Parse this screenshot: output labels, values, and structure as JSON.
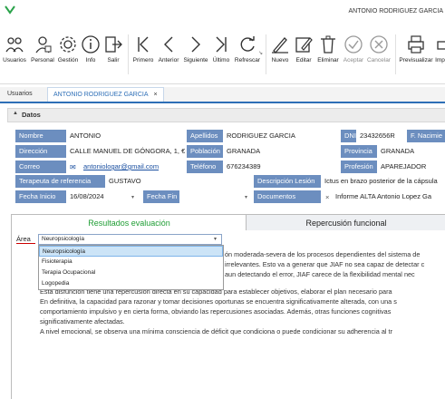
{
  "titlebar": {
    "user": "ANTONIO RODRIGUEZ GARCIA"
  },
  "ribbon": {
    "buttons": [
      {
        "label": "Usuarios",
        "icon": "users-icon"
      },
      {
        "label": "Personal",
        "icon": "staff-icon"
      },
      {
        "label": "Gestión",
        "icon": "gear-icon"
      },
      {
        "label": "Info",
        "icon": "info-icon"
      },
      {
        "label": "Salir",
        "icon": "exit-icon"
      },
      {
        "label": "Primero",
        "icon": "first-icon"
      },
      {
        "label": "Anterior",
        "icon": "previous-icon"
      },
      {
        "label": "Siguiente",
        "icon": "next-icon"
      },
      {
        "label": "Último",
        "icon": "last-icon"
      },
      {
        "label": "Refrescar",
        "icon": "refresh-icon"
      },
      {
        "label": "Nuevo",
        "icon": "new-icon"
      },
      {
        "label": "Editar",
        "icon": "edit-icon"
      },
      {
        "label": "Eliminar",
        "icon": "delete-icon"
      },
      {
        "label": "Aceptar",
        "icon": "accept-icon"
      },
      {
        "label": "Cancelar",
        "icon": "cancel-icon"
      },
      {
        "label": "Previsualizar",
        "icon": "print-preview-icon"
      },
      {
        "label": "Imp",
        "icon": "print-icon"
      }
    ]
  },
  "tabs": {
    "usuarios": "Usuarios",
    "antonio": "ANTONIO RODRIGUEZ GARCIA",
    "close": "×"
  },
  "section": {
    "title": "Datos",
    "collapse": "▲"
  },
  "fields": {
    "nombre_label": "Nombre",
    "nombre": "ANTONIO",
    "apellidos_label": "Apellidos",
    "apellidos": "RODRIGUEZ GARCIA",
    "dni_label": "DNI",
    "dni": "23432656R",
    "fnac_label": "F. Nacimie",
    "direccion_label": "Dirección",
    "direccion": "CALLE MANUEL DE GÓNGORA, 1, €",
    "poblacion_label": "Población",
    "poblacion": "GRANADA",
    "provincia_label": "Provincia",
    "provincia": "GRANADA",
    "correo_label": "Correo",
    "correo": "antoniologar@gmail.com",
    "telefono_label": "Teléfono",
    "telefono": "676234389",
    "profesion_label": "Profesión",
    "profesion": "APAREJADOR",
    "terapeuta_label": "Terapeuta de referencia",
    "terapeuta": "GUSTAVO",
    "desc_label": "Descripción Lesión",
    "desc": "Ictus en brazo posterior de la cápsula",
    "finicio_label": "Fecha Inicio",
    "finicio": "16/08/2024",
    "ffin_label": "Fecha Fin",
    "docs_label": "Documentos",
    "docs": "Informe ALTA Antonio Lopez Ga",
    "docs_close": "×"
  },
  "inner_tabs": {
    "resultados": "Resultados evaluación",
    "repercusion": "Repercusión funcional"
  },
  "area": {
    "label": "Área",
    "selected": "Neuropsicología",
    "options": [
      "Neuropsicología",
      "Fisioterapia",
      "Terapia Ocupacional",
      "Logopedia"
    ]
  },
  "text_lines": [
    "ón moderada-severa de los procesos dependientes del sistema de",
    "irrelevantes. Esto va a generar que JIAF no sea capaz de detectar c",
    "aun detectando el error, JIAF carece de la flexibilidad mental nec",
    "Esta disfunción tiene una repercusión directa en su capacidad para establecer objetivos, elaborar el plan necesario para",
    "En definitiva, la capacidad para razonar y tomar decisiones oportunas se encuentra significativamente alterada, con una s",
    "comportamiento impulsivo y en cierta forma, obviando las repercusiones asociadas. Además, otras funciones cognitivas",
    "significativamente afectadas.",
    "A nivel emocional, se observa una mínima consciencia de déficit que condiciona o puede condicionar su adherencia al tr"
  ],
  "colors": {
    "label_bg": "#6c8ebf",
    "accent": "#2e6fb7",
    "tab_green": "#1f9d34"
  }
}
